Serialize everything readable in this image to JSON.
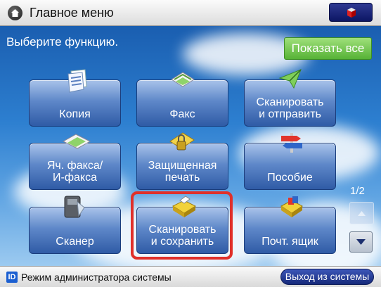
{
  "header": {
    "title": "Главное меню",
    "home_icon": "home-icon",
    "top_button_icon": "cube-icon"
  },
  "instruction": "Выберите функцию.",
  "show_all_label": "Показать все",
  "functions": [
    {
      "label": "Копия",
      "icon": "copy-icon"
    },
    {
      "label": "Факс",
      "icon": "fax-icon"
    },
    {
      "label": "Сканировать\nи отправить",
      "icon": "scan-send-icon"
    },
    {
      "label": "Яч. факса/\nИ-факса",
      "icon": "fax-inbox-icon"
    },
    {
      "label": "Защищенная\nпечать",
      "icon": "secure-print-icon"
    },
    {
      "label": "Пособие",
      "icon": "guide-icon"
    },
    {
      "label": "Сканер",
      "icon": "scanner-icon"
    },
    {
      "label": "Сканировать\nи сохранить",
      "icon": "scan-save-icon"
    },
    {
      "label": "Почт. ящик",
      "icon": "mailbox-icon"
    }
  ],
  "page_indicator": "1/2",
  "status": {
    "text": "Режим администратора системы",
    "id_icon": "ID",
    "logout_label": "Выход из системы"
  },
  "colors": {
    "highlight": "#e0302a",
    "show_all": "#6cc24a",
    "logout": "#1c2f86"
  }
}
